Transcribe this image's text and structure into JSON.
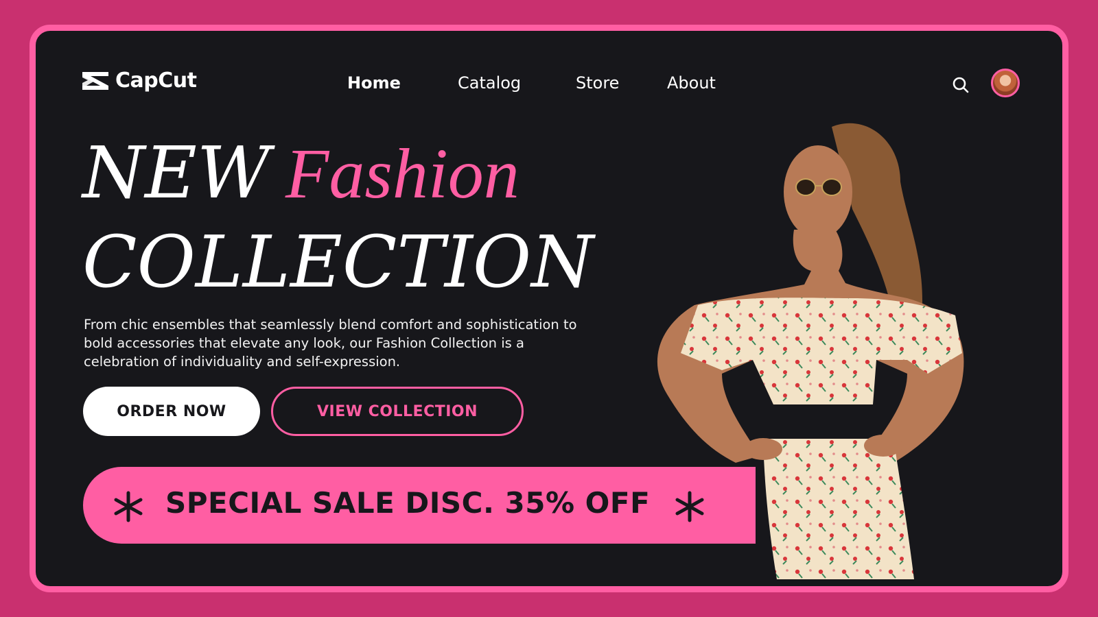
{
  "brand": {
    "name": "CapCut"
  },
  "nav": {
    "items": [
      {
        "label": "Home",
        "active": true
      },
      {
        "label": "Catalog",
        "active": false
      },
      {
        "label": "Store",
        "active": false
      },
      {
        "label": "About",
        "active": false
      }
    ]
  },
  "header_icons": {
    "search": "search-icon",
    "avatar": "user-avatar"
  },
  "hero": {
    "word_new": "NEW",
    "word_fashion": "Fashion",
    "word_collection": "COLLECTION",
    "description": "From chic ensembles that seamlessly blend comfort and sophistication to bold accessories that elevate any look, our Fashion Collection is a celebration of individuality and self-expression."
  },
  "buttons": {
    "order_now": "ORDER NOW",
    "view_collection": "VIEW COLLECTION"
  },
  "sale_banner": {
    "text": "SPECIAL SALE DISC. 35% OFF"
  },
  "colors": {
    "accent_pink": "#ff5ea3",
    "outer_background": "#c9306f",
    "panel_background": "#17171b",
    "text_white": "#ffffff"
  }
}
